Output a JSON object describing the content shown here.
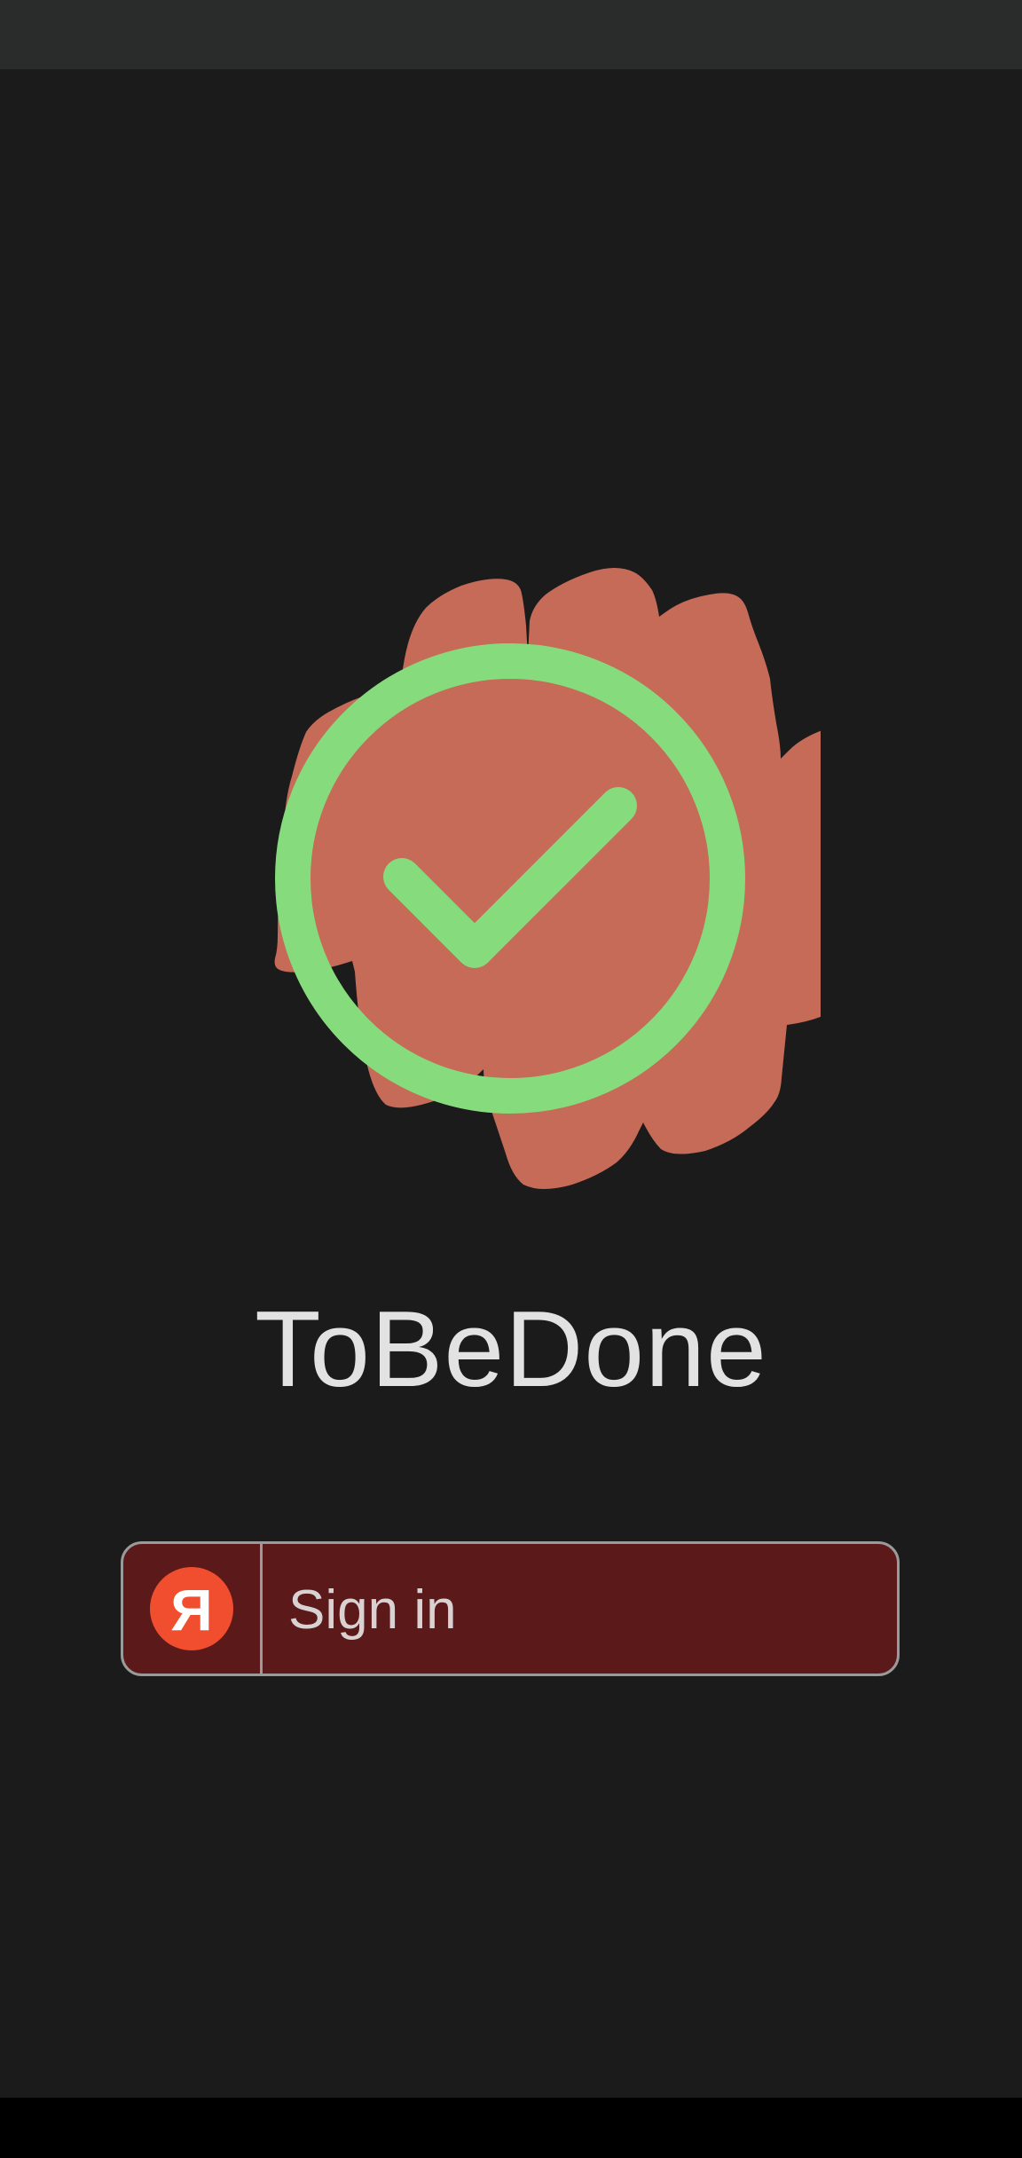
{
  "app": {
    "title": "ToBeDone"
  },
  "logo": {
    "icon": "check-seal-icon",
    "blob_color": "#c56b58",
    "check_color": "#86dc7c"
  },
  "signin": {
    "label": "Sign in",
    "provider_icon": "yandex-icon",
    "provider_glyph": "Я",
    "button_color": "#5b1919",
    "provider_color": "#f04e2f"
  },
  "theme": {
    "background": "#1b1b1b",
    "status_bar": "#2a2b2b",
    "nav_bar": "#000000"
  }
}
